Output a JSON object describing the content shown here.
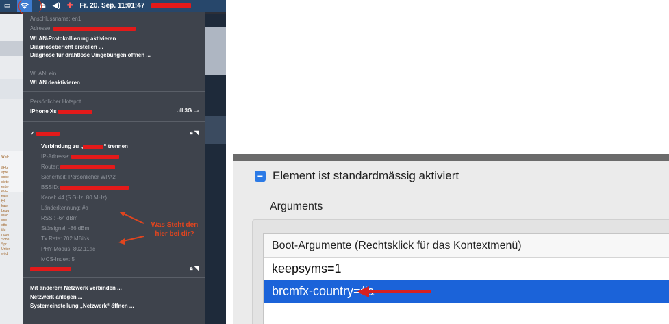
{
  "menubar": {
    "date_time": "Fr. 20. Sep.  11:01:47"
  },
  "wifi_menu": {
    "interface_name_label": "Anschlussname: en1",
    "address_label": "Adresse:",
    "enable_logging": "WLAN-Protokollierung aktivieren",
    "create_diagnostics": "Diagnosebericht erstellen ...",
    "open_wireless_diagnostics": "Diagnose für drahtlose Umgebungen öffnen ...",
    "wlan_status": "WLAN: ein",
    "wlan_disable": "WLAN deaktivieren",
    "hotspot_header": "Persönlicher Hotspot",
    "hotspot_device": "iPhone Xs",
    "hotspot_signal": "3G",
    "connected_check": "✓",
    "disconnect_prefix": "Verbindung zu „",
    "disconnect_suffix": "“ trennen",
    "details": [
      "IP-Adresse:",
      "Router:",
      "Sicherheit: Persönlicher WPA2",
      "BSSID:",
      "Kanal: 44 (5 GHz, 80 MHz)",
      "Länderkennung: #a",
      "RSSI: -64 dBm",
      "Störsignal: -86 dBm",
      "Tx Rate: 702 MBit/s",
      "PHY-Modus: 802.11ac",
      "MCS-Index: 5"
    ],
    "other_network": "Mit anderem Netzwerk verbinden ...",
    "create_network": "Netzwerk anlegen ...",
    "open_network_prefs": "Systemeinstellung „Netzwerk“ öffnen ..."
  },
  "annotation": {
    "line1": "Was Steht den",
    "line2": "hier bei dir?"
  },
  "config": {
    "checkbox_label": "Element ist standardmässig aktiviert",
    "checkbox_glyph": "−",
    "arguments_title": "Arguments",
    "table_header": "Boot-Argumente (Rechtsklick für das Kontextmenü)",
    "rows": [
      "keepsyms=1",
      "brcmfx-country=#a"
    ]
  },
  "colors": {
    "accent_blue": "#1b63d9",
    "annotation_red": "#e0451f"
  }
}
